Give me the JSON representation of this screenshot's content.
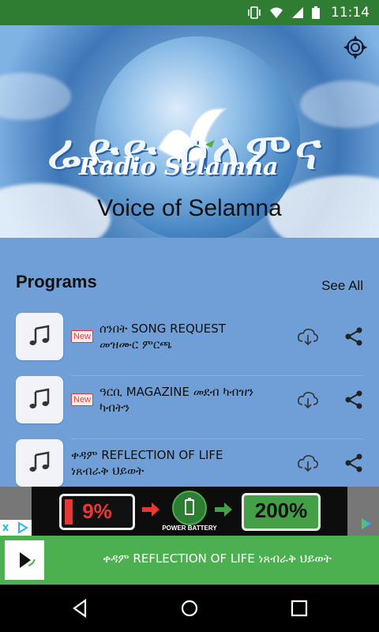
{
  "status_bar": {
    "time": "11:14"
  },
  "header": {
    "logo_text": "ሬድዮ ሰላምና",
    "logo_subtext": "Radio Selamna",
    "tagline": "Voice of Selamna"
  },
  "programs": {
    "title": "Programs",
    "see_all": "See All",
    "items": [
      {
        "badge": "New",
        "line1": "ሰንበት SONG REQUEST",
        "line2": "መዝሙር ምርጫ"
      },
      {
        "badge": "New",
        "line1": "ዓርቢ MAGAZINE መደብ ካብዝን",
        "line2": "ካብትን"
      },
      {
        "badge": "",
        "line1": "ቀዳም REFLECTION OF LIFE",
        "line2": "ነጸብራቅ ህይወት"
      }
    ]
  },
  "ad": {
    "percent_low": "9%",
    "percent_high": "200%",
    "brand": "POWER BATTERY"
  },
  "now_playing": {
    "title": "ቀዳም REFLECTION OF LIFE ነጸብራቅ ህይወት"
  },
  "colors": {
    "status": "#2e7d32",
    "background": "#6f9fd6",
    "now_playing": "#4caf50"
  }
}
